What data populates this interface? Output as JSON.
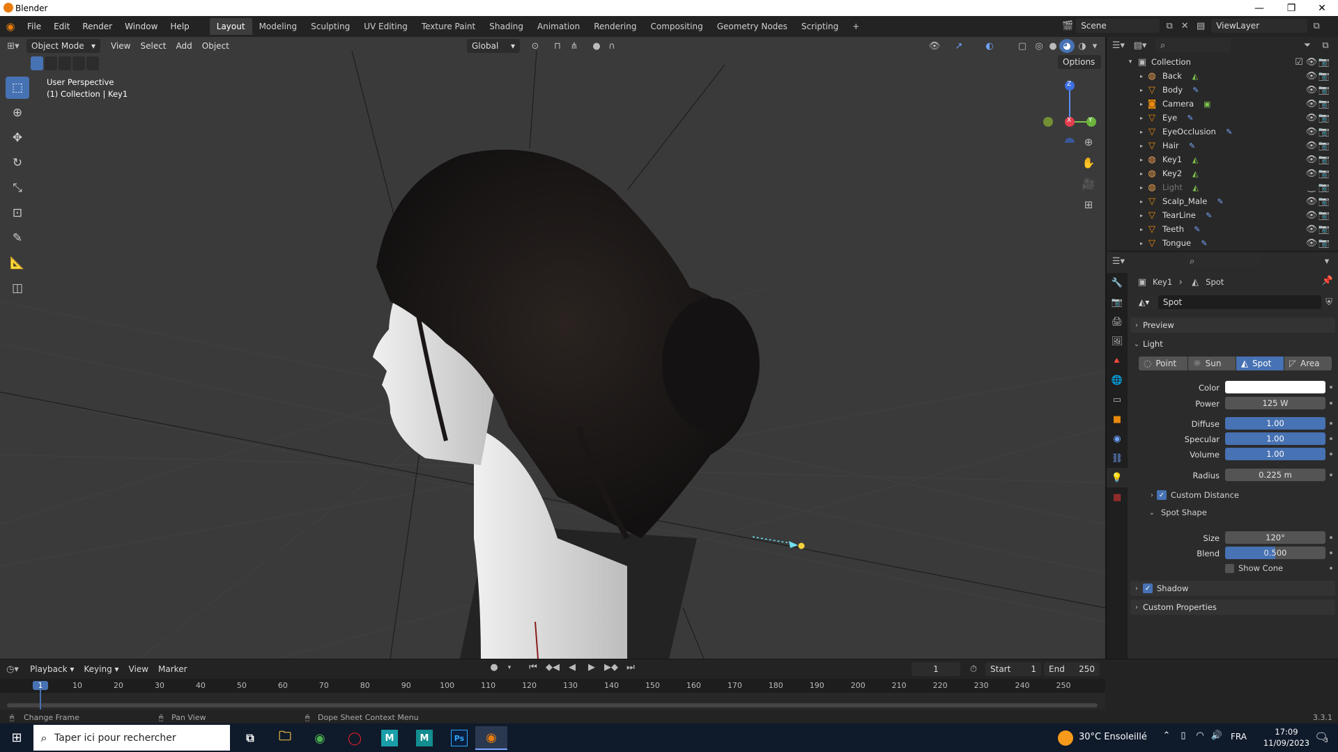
{
  "window": {
    "title": "Blender",
    "min": "—",
    "max": "❐",
    "close": "✕"
  },
  "menubar": {
    "menus": [
      "File",
      "Edit",
      "Render",
      "Window",
      "Help"
    ],
    "workspaces": [
      "Layout",
      "Modeling",
      "Sculpting",
      "UV Editing",
      "Texture Paint",
      "Shading",
      "Animation",
      "Rendering",
      "Compositing",
      "Geometry Nodes",
      "Scripting"
    ],
    "active_workspace": "Layout",
    "add_tab": "+",
    "scene": "Scene",
    "view_layer": "ViewLayer"
  },
  "viewport": {
    "mode": "Object Mode",
    "menus": [
      "View",
      "Select",
      "Add",
      "Object"
    ],
    "transform_orientation": "Global",
    "options": "Options",
    "overlay_line1": "User Perspective",
    "overlay_line2": "(1) Collection | Key1",
    "gizmo": {
      "z": "Z",
      "x": "X",
      "y": "Y"
    }
  },
  "outliner": {
    "collection": "Collection",
    "items": [
      {
        "name": "Back",
        "kind": "light",
        "dim": false
      },
      {
        "name": "Body",
        "kind": "mesh",
        "dim": false
      },
      {
        "name": "Camera",
        "kind": "camera",
        "dim": false
      },
      {
        "name": "Eye",
        "kind": "mesh",
        "dim": false
      },
      {
        "name": "EyeOcclusion",
        "kind": "mesh",
        "dim": false
      },
      {
        "name": "Hair",
        "kind": "mesh",
        "dim": false
      },
      {
        "name": "Key1",
        "kind": "light",
        "dim": false
      },
      {
        "name": "Key2",
        "kind": "light",
        "dim": false
      },
      {
        "name": "Light",
        "kind": "light",
        "dim": true
      },
      {
        "name": "Scalp_Male",
        "kind": "mesh",
        "dim": false
      },
      {
        "name": "TearLine",
        "kind": "mesh",
        "dim": false
      },
      {
        "name": "Teeth",
        "kind": "mesh",
        "dim": false
      },
      {
        "name": "Tongue",
        "kind": "mesh",
        "dim": false
      }
    ]
  },
  "properties": {
    "breadcrumb_object": "Key1",
    "breadcrumb_data": "Spot",
    "datablock": "Spot",
    "preview": "Preview",
    "light_section": "Light",
    "types": [
      "Point",
      "Sun",
      "Spot",
      "Area"
    ],
    "active_type": "Spot",
    "color_label": "Color",
    "power_label": "Power",
    "power": "125 W",
    "diffuse_label": "Diffuse",
    "diffuse": "1.00",
    "specular_label": "Specular",
    "specular": "1.00",
    "volume_label": "Volume",
    "volume": "1.00",
    "radius_label": "Radius",
    "radius": "0.225 m",
    "custom_distance": "Custom Distance",
    "spot_shape": "Spot Shape",
    "size_label": "Size",
    "size": "120°",
    "blend_label": "Blend",
    "blend": "0.500",
    "show_cone": "Show Cone",
    "shadow": "Shadow",
    "custom_properties": "Custom Properties"
  },
  "timeline": {
    "menus": [
      "Playback",
      "Keying",
      "View",
      "Marker"
    ],
    "current_frame": "1",
    "start_label": "Start",
    "start": "1",
    "end_label": "End",
    "end": "250",
    "ruler": [
      "1",
      "10",
      "20",
      "30",
      "40",
      "50",
      "60",
      "70",
      "80",
      "90",
      "100",
      "110",
      "120",
      "130",
      "140",
      "150",
      "160",
      "170",
      "180",
      "190",
      "200",
      "210",
      "220",
      "230",
      "240",
      "250"
    ]
  },
  "statusbar": {
    "left": "Change Frame",
    "middle": "Pan View",
    "right": "Dope Sheet Context Menu",
    "version": "3.3.1"
  },
  "taskbar": {
    "search": "Taper ici pour rechercher",
    "weather": "30°C Ensoleillé",
    "lang": "FRA",
    "time": "17:09",
    "date": "11/09/2023",
    "notif": "3"
  },
  "colors": {
    "accent": "#4772b3",
    "blender_orange": "#e87d0d",
    "viewport_bg": "#3a3a3a"
  }
}
